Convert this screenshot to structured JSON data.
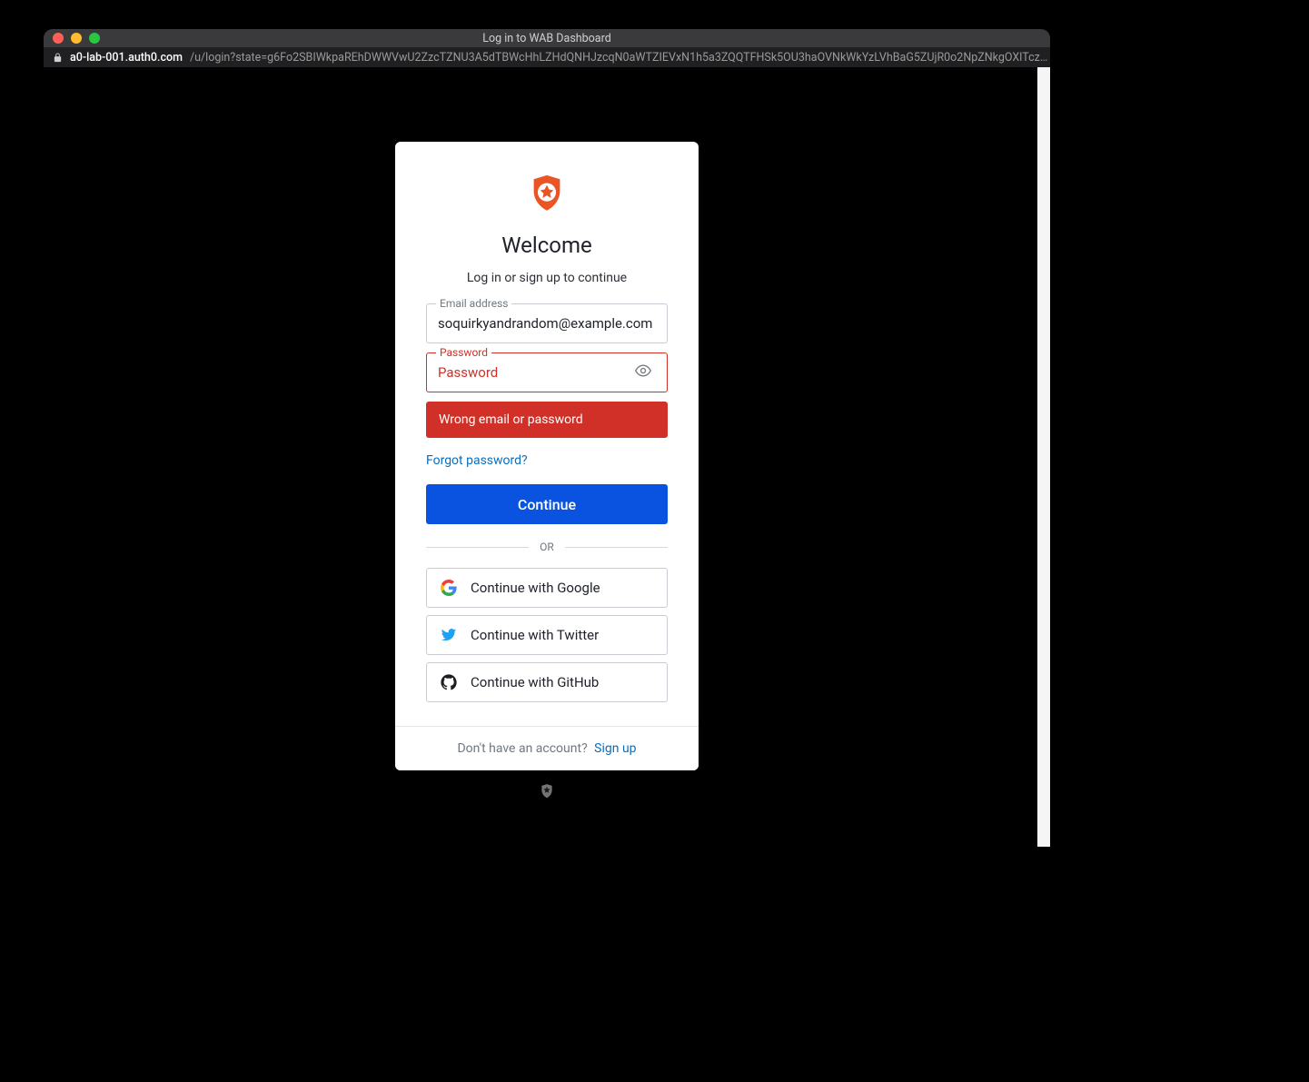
{
  "window": {
    "title": "Log in to WAB Dashboard",
    "url_host": "a0-lab-001.auth0.com",
    "url_rest": "/u/login?state=g6Fo2SBIWkpaREhDWWVwU2ZzcTZNU3A5dTBWcHhLZHdQNHJzcqN0aWTZIEVxN1h5a3ZQQTFHSk5OU3haOVNkWkYzLVhBaG5ZUjR0o2NpZNkgOXlTcz…"
  },
  "login": {
    "heading": "Welcome",
    "subtitle": "Log in or sign up to continue",
    "email_label": "Email address",
    "email_value": "soquirkyandrandom@example.com",
    "password_label": "Password",
    "password_placeholder": "Password",
    "error_message": "Wrong email or password",
    "forgot_link": "Forgot password?",
    "continue_label": "Continue",
    "divider_label": "OR",
    "social": {
      "google": "Continue with Google",
      "twitter": "Continue with Twitter",
      "github": "Continue with GitHub"
    },
    "footer_text": "Don't have an account?",
    "signup_link": "Sign up"
  },
  "colors": {
    "brand_orange": "#eb5424",
    "error_red": "#d03027",
    "primary_blue": "#0a53e0",
    "link_blue": "#0a6ebd"
  }
}
